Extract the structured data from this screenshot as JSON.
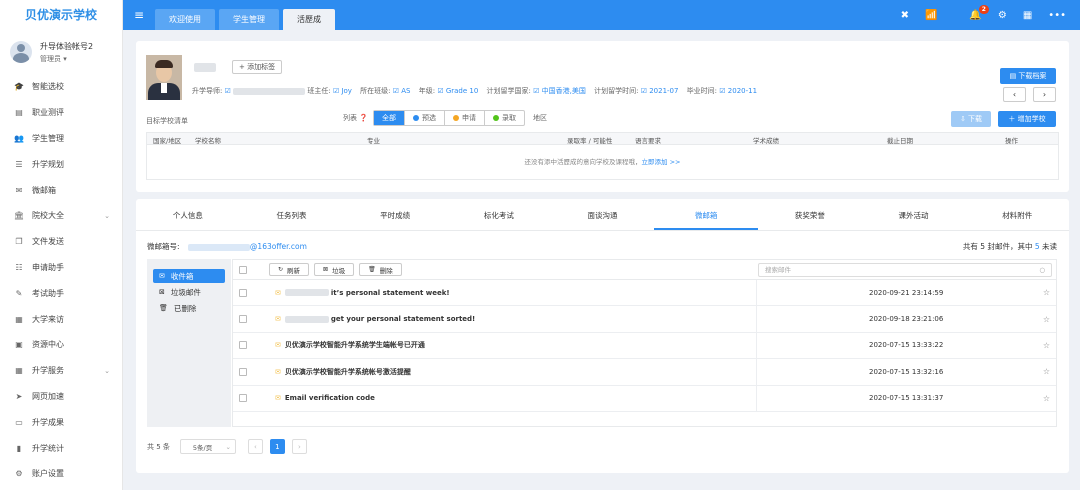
{
  "app": {
    "logo": "贝优演示学校"
  },
  "user": {
    "name": "升导体验帐号2",
    "role": "管理员 ▾"
  },
  "sidebar": {
    "items": [
      {
        "label": "智能选校",
        "icon": "graduation-cap-icon",
        "glyph": "🎓"
      },
      {
        "label": "职业测评",
        "icon": "clipboard-icon",
        "glyph": "▤"
      },
      {
        "label": "学生管理",
        "icon": "users-icon",
        "glyph": "👥"
      },
      {
        "label": "升学规划",
        "icon": "list-icon",
        "glyph": "☰"
      },
      {
        "label": "微邮箱",
        "icon": "mail-icon",
        "glyph": "✉"
      },
      {
        "label": "院校大全",
        "icon": "bank-icon",
        "glyph": "🏛",
        "arrow": "⌄"
      },
      {
        "label": "文件发送",
        "icon": "files-icon",
        "glyph": "❐"
      },
      {
        "label": "申请助手",
        "icon": "list-icon",
        "glyph": "☷"
      },
      {
        "label": "考试助手",
        "icon": "edit-icon",
        "glyph": "✎"
      },
      {
        "label": "大学来访",
        "icon": "calendar-icon",
        "glyph": "▦"
      },
      {
        "label": "资源中心",
        "icon": "briefcase-icon",
        "glyph": "▣"
      },
      {
        "label": "升学服务",
        "icon": "grid-icon",
        "glyph": "▦",
        "arrow": "⌄"
      },
      {
        "label": "网页加速",
        "icon": "send-icon",
        "glyph": "➤"
      },
      {
        "label": "升学成果",
        "icon": "id-card-icon",
        "glyph": "▭"
      },
      {
        "label": "升学统计",
        "icon": "bar-chart-icon",
        "glyph": "▮"
      },
      {
        "label": "账户设置",
        "icon": "gear-icon",
        "glyph": "⚙"
      }
    ]
  },
  "topbar": {
    "menu_glyph": "≡",
    "tabs": [
      {
        "label": "欢迎使用"
      },
      {
        "label": "学生管理"
      },
      {
        "label": "活歷成"
      }
    ],
    "notification_count": "2",
    "icons": {
      "close": "✖",
      "wifi": "📶",
      "bell": "🔔",
      "gear": "⚙",
      "calendar": "▦",
      "more": "•••"
    }
  },
  "profile": {
    "add_tag": "+ 添加标签",
    "mentor_label": "升学导师:",
    "head_teacher_label": "班主任:",
    "head_teacher": "☑ Joy",
    "class_label": "所在班级:",
    "class_value": "☑ AS",
    "grade_label": "年级:",
    "grade_value": "☑ Grade 10",
    "country_label": "计划留学国家:",
    "country_value": "☑ 中国香港,美国",
    "study_time_label": "计划留学时间:",
    "study_time_value": "☑ 2021-07",
    "grad_time_label": "毕业时间:",
    "grad_time_value": "☑ 2020-11",
    "download_btn": "▤ 下载档案",
    "prev": "‹",
    "next": "›"
  },
  "targets": {
    "title": "目标学校清单",
    "filter_label": "列表 ❓",
    "filters": [
      {
        "label": "全部",
        "color": ""
      },
      {
        "label": "预选",
        "color": "#2d8cf0"
      },
      {
        "label": "申请",
        "color": "#f5a623"
      },
      {
        "label": "录取",
        "color": "#52c41a"
      }
    ],
    "region_label": "地区",
    "download": "⇩ 下载",
    "add": "＋ 增加学校",
    "columns": [
      "国家/地区",
      "学校名称",
      "专业",
      "录取率 / 可能性",
      "语言要求",
      "学术成绩",
      "截止日期",
      "操作"
    ],
    "empty_text": "还没有添中活歷成的意向学校及课程哦，",
    "empty_link": "立即添加 >>"
  },
  "detail_tabs": [
    {
      "label": "个人信息"
    },
    {
      "label": "任务列表"
    },
    {
      "label": "平时成绩"
    },
    {
      "label": "标化考试"
    },
    {
      "label": "面谈沟通"
    },
    {
      "label": "微邮箱"
    },
    {
      "label": "获奖荣誉"
    },
    {
      "label": "课外活动"
    },
    {
      "label": "材料附件"
    }
  ],
  "mail": {
    "address_label": "微邮箱号:",
    "address_suffix": "@163offer.com",
    "count_prefix": "共有 5 封邮件，其中",
    "unread": " 5 ",
    "count_suffix": "未读",
    "folders": [
      {
        "label": "收件箱",
        "glyph": "✉"
      },
      {
        "label": "垃圾邮件",
        "glyph": "⊠"
      },
      {
        "label": "已删除",
        "glyph": "🗑"
      }
    ],
    "toolbar": {
      "refresh": "刷新",
      "spam": "垃圾",
      "delete": "删除",
      "search_placeholder": "搜索邮件"
    },
    "rows": [
      {
        "subject": "it’s personal statement week!",
        "date": "2020-09-21 23:14:59",
        "redacted": true
      },
      {
        "subject": "get your personal statement sorted!",
        "date": "2020-09-18 23:21:06",
        "redacted": true
      },
      {
        "subject": "贝优演示学校智能升学系统学生端帐号已开通",
        "date": "2020-07-15 13:33:22",
        "redacted": false
      },
      {
        "subject": "贝优演示学校智能升学系统帐号激活提醒",
        "date": "2020-07-15 13:32:16",
        "redacted": false
      },
      {
        "subject": "Email verification code",
        "date": "2020-07-15 13:31:37",
        "redacted": false
      }
    ]
  },
  "pagination": {
    "total": "共 5 条",
    "page_size": "5条/页",
    "prev": "‹",
    "current": "1",
    "next": "›"
  }
}
